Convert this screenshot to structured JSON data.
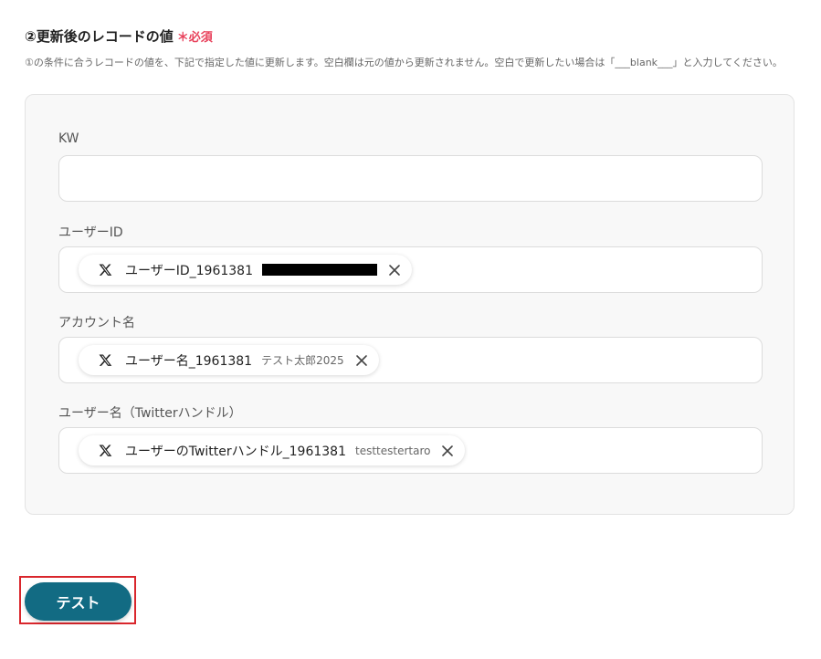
{
  "section": {
    "title": "②更新後のレコードの値",
    "required_mark": "＊必須",
    "description": "①の条件に合うレコードの値を、下記で指定した値に更新します。空白欄は元の値から更新されません。空白で更新したい場合は「___blank___」と入力してください。"
  },
  "fields": [
    {
      "label": "KW",
      "value": ""
    },
    {
      "label": "ユーザーID",
      "chip": {
        "icon": "x-logo-icon",
        "label": "ユーザーID_1961381",
        "value_redacted": true
      }
    },
    {
      "label": "アカウント名",
      "chip": {
        "icon": "x-logo-icon",
        "label": "ユーザー名_1961381",
        "value": "テスト太郎2025"
      }
    },
    {
      "label": "ユーザー名（Twitterハンドル）",
      "chip": {
        "icon": "x-logo-icon",
        "label": "ユーザーのTwitterハンドル_1961381",
        "value": "testtestertaro"
      }
    }
  ],
  "actions": {
    "test_label": "テスト"
  },
  "colors": {
    "accent": "#126b83",
    "required": "#e8415b",
    "highlight": "#d9262c"
  }
}
